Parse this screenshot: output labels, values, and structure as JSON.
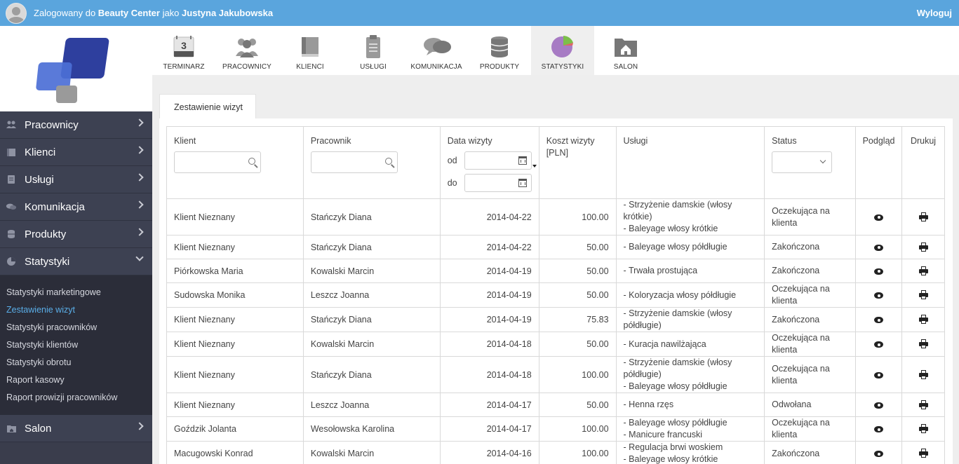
{
  "topbar": {
    "prefix": "Zalogowany do",
    "company": "Beauty Center",
    "middle": "jako",
    "user": "Justyna Jakubowska",
    "logout": "Wyloguj"
  },
  "toolbar": [
    {
      "label": "TERMINARZ",
      "icon": "calendar-icon",
      "badge": "3"
    },
    {
      "label": "PRACOWNICY",
      "icon": "people-icon"
    },
    {
      "label": "KLIENCI",
      "icon": "book-icon"
    },
    {
      "label": "USŁUGI",
      "icon": "clipboard-icon"
    },
    {
      "label": "KOMUNIKACJA",
      "icon": "chat-icon"
    },
    {
      "label": "PRODUKTY",
      "icon": "database-icon"
    },
    {
      "label": "STATYSTYKI",
      "icon": "pie-chart-icon"
    },
    {
      "label": "SALON",
      "icon": "folder-home-icon"
    }
  ],
  "sidebar": {
    "items": [
      {
        "label": "Pracownicy",
        "icon": "people-icon"
      },
      {
        "label": "Klienci",
        "icon": "book-icon"
      },
      {
        "label": "Usługi",
        "icon": "clipboard-icon"
      },
      {
        "label": "Komunikacja",
        "icon": "chat-icon"
      },
      {
        "label": "Produkty",
        "icon": "database-icon"
      },
      {
        "label": "Statystyki",
        "icon": "pie-chart-icon"
      }
    ],
    "subitems": [
      "Statystyki marketingowe",
      "Zestawienie wizyt",
      "Statystyki pracowników",
      "Statystyki klientów",
      "Statystyki obrotu",
      "Raport kasowy",
      "Raport prowizji pracowników"
    ],
    "salon": "Salon"
  },
  "tab": "Zestawienie wizyt",
  "table": {
    "headers": {
      "client": "Klient",
      "employee": "Pracownik",
      "date": "Data wizyty",
      "from": "od",
      "to": "do",
      "cost": "Koszt wizyty [PLN]",
      "services": "Usługi",
      "status": "Status",
      "preview": "Podgląd",
      "print": "Drukuj"
    },
    "rows": [
      {
        "client": "Klient Nieznany",
        "employee": "Stańczyk Diana",
        "date": "2014-04-22",
        "cost": "100.00",
        "services": [
          "- Strzyżenie damskie (włosy",
          "krótkie)",
          "- Baleyage włosy krótkie"
        ],
        "status": [
          "Oczekująca na",
          "klienta"
        ]
      },
      {
        "client": "Klient Nieznany",
        "employee": "Stańczyk Diana",
        "date": "2014-04-22",
        "cost": "50.00",
        "services": [
          "- Baleyage włosy półdługie"
        ],
        "status": [
          "Zakończona"
        ]
      },
      {
        "client": "Piórkowska Maria",
        "employee": "Kowalski Marcin",
        "date": "2014-04-19",
        "cost": "50.00",
        "services": [
          "- Trwała prostująca"
        ],
        "status": [
          "Zakończona"
        ]
      },
      {
        "client": "Sudowska Monika",
        "employee": "Leszcz Joanna",
        "date": "2014-04-19",
        "cost": "50.00",
        "services": [
          "- Koloryzacja włosy półdługie"
        ],
        "status": [
          "Oczekująca na",
          "klienta"
        ]
      },
      {
        "client": "Klient Nieznany",
        "employee": "Stańczyk Diana",
        "date": "2014-04-19",
        "cost": "75.83",
        "services": [
          "- Strzyżenie damskie (włosy",
          "półdługie)"
        ],
        "status": [
          "Zakończona"
        ]
      },
      {
        "client": "Klient Nieznany",
        "employee": "Kowalski Marcin",
        "date": "2014-04-18",
        "cost": "50.00",
        "services": [
          "- Kuracja nawilżająca"
        ],
        "status": [
          "Oczekująca na",
          "klienta"
        ]
      },
      {
        "client": "Klient Nieznany",
        "employee": "Stańczyk Diana",
        "date": "2014-04-18",
        "cost": "100.00",
        "services": [
          "- Strzyżenie damskie (włosy",
          "półdługie)",
          "- Baleyage włosy półdługie"
        ],
        "status": [
          "Oczekująca na",
          "klienta"
        ]
      },
      {
        "client": "Klient Nieznany",
        "employee": "Leszcz Joanna",
        "date": "2014-04-17",
        "cost": "50.00",
        "services": [
          "- Henna rzęs"
        ],
        "status": [
          "Odwołana"
        ]
      },
      {
        "client": "Goździk Jolanta",
        "employee": "Wesołowska Karolina",
        "date": "2014-04-17",
        "cost": "100.00",
        "services": [
          "- Baleyage włosy półdługie",
          "- Manicure francuski"
        ],
        "status": [
          "Oczekująca na",
          "klienta"
        ]
      },
      {
        "client": "Macugowski Konrad",
        "employee": "Kowalski Marcin",
        "date": "2014-04-16",
        "cost": "100.00",
        "services": [
          "- Regulacja brwi woskiem",
          "- Baleyage włosy krótkie"
        ],
        "status": [
          "Zakończona"
        ]
      }
    ]
  }
}
